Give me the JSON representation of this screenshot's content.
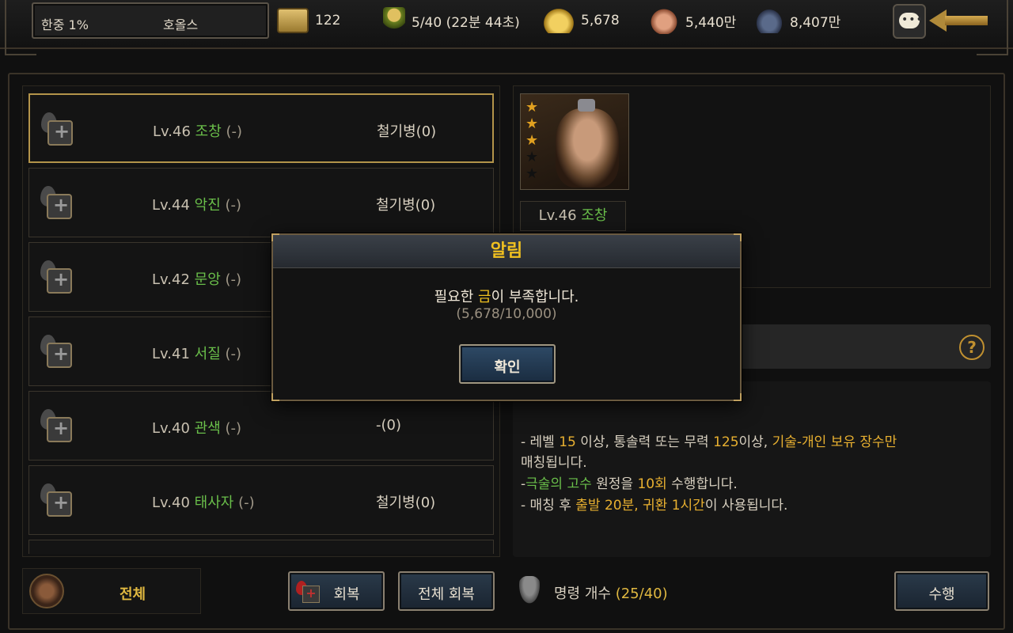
{
  "topbar": {
    "region_name": "한중 1%",
    "player_name": "호올스",
    "scrolls": "122",
    "stamina": "5/40 (22분 44초)",
    "gold": "5,678",
    "food": "5,440만",
    "ore": "8,407만"
  },
  "officers": [
    {
      "level": "Lv.46",
      "name": "조창",
      "suffix": "(-)",
      "troop": "철기병(0)",
      "selected": true
    },
    {
      "level": "Lv.44",
      "name": "악진",
      "suffix": "(-)",
      "troop": "철기병(0)",
      "selected": false
    },
    {
      "level": "Lv.42",
      "name": "문앙",
      "suffix": "(-)",
      "troop": "",
      "selected": false
    },
    {
      "level": "Lv.41",
      "name": "서질",
      "suffix": "(-)",
      "troop": "",
      "selected": false
    },
    {
      "level": "Lv.40",
      "name": "관색",
      "suffix": "(-)",
      "troop": "-(0)",
      "selected": false
    },
    {
      "level": "Lv.40",
      "name": "태사자",
      "suffix": "(-)",
      "troop": "철기병(0)",
      "selected": false
    }
  ],
  "bottom": {
    "filter_label": "전체",
    "heal_button": "회복",
    "heal_all_button": "전체 회복",
    "command_label": "명령 개수",
    "command_count": "(25/40)",
    "execute_button": "수행"
  },
  "portrait": {
    "stars": [
      "★",
      "★",
      "★",
      "★",
      "★"
    ],
    "star_colors": [
      "#e0a020",
      "#e0a020",
      "#e0a020",
      "#111111",
      "#111111"
    ],
    "level": "Lv.46",
    "name": "조창"
  },
  "help_icon": "?",
  "description": {
    "line1_a": "- 레벨 ",
    "line1_b": "15",
    "line1_c": " 이상, 통솔력 또는 무력 ",
    "line1_d": "125",
    "line1_e": "이상, ",
    "line1_f": "기술-개인 보유 장수만",
    "line2": "매칭됩니다.",
    "line3_a": "-",
    "line3_b": "극술의 고수",
    "line3_c": " 원정을 ",
    "line3_d": "10회",
    "line3_e": " 수행합니다.",
    "line4_a": "- 매칭 후 ",
    "line4_b": "출발 20분, 귀환 1시간",
    "line4_c": "이 사용됩니다."
  },
  "modal": {
    "title": "알림",
    "msg_a": "필요한 ",
    "msg_b": "금",
    "msg_c": "이 부족합니다.",
    "sub": "(5,678/10,000)",
    "ok": "확인"
  },
  "colors": {
    "accent_gold": "#f0c020",
    "name_green": "#6abf4a",
    "frame_border": "#b3944a"
  }
}
